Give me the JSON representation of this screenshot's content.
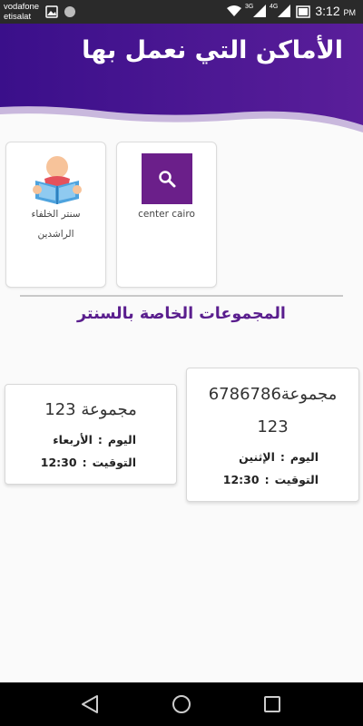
{
  "status_bar": {
    "carrier_1": "vodafone",
    "carrier_2": "etisalat",
    "time": "3:12",
    "ampm": "PM",
    "net_1": "3G",
    "net_2": "4G"
  },
  "header": {
    "title": "الأماكن التي نعمل بها",
    "gradient_start": "#3a0f8a",
    "gradient_end": "#5a1e9a"
  },
  "places": [
    {
      "name_line1": "سنتر الخلفاء",
      "name_line2": "الراشدين",
      "icon": "person-reading-icon"
    },
    {
      "name": "center cairo",
      "icon": "search-icon",
      "icon_bg": "#6b1f8a"
    }
  ],
  "section_title": "المجموعات الخاصة بالسنتر",
  "groups": [
    {
      "name_line1": "مجموعة6786786",
      "name_line2": "123",
      "day_label": "اليوم",
      "day_value": "الإثنين",
      "time_label": "التوقيت",
      "time_value": "12:30"
    },
    {
      "name_line1": "مجموعة 123",
      "day_label": "اليوم",
      "day_value": "الأربعاء",
      "time_label": "التوقيت",
      "time_value": "12:30"
    }
  ],
  "separator": ":",
  "nav": {
    "back": "back-icon",
    "home": "home-icon",
    "recents": "recents-icon"
  }
}
